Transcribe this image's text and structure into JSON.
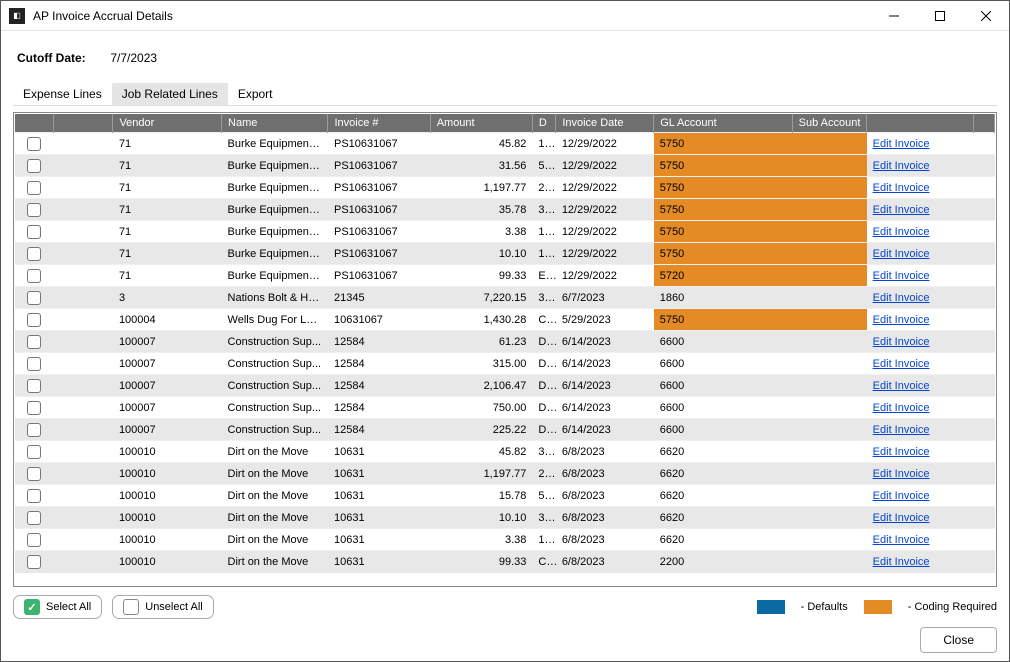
{
  "window": {
    "title": "AP Invoice Accrual Details"
  },
  "cutoff": {
    "label": "Cutoff Date:",
    "value": "7/7/2023"
  },
  "tabs": {
    "expense": "Expense Lines",
    "job": "Job Related Lines",
    "export": "Export"
  },
  "columns": {
    "checkbox": "",
    "row_handle": "",
    "vendor": "Vendor",
    "name": "Name",
    "invoice_no": "Invoice #",
    "amount": "Amount",
    "d": "D",
    "invoice_date": "Invoice Date",
    "gl_account": "GL Account",
    "sub_account": "Sub Account",
    "action": ""
  },
  "rows": [
    {
      "vendor": "71",
      "name": "Burke Equipment ...",
      "invoice_no": "PS10631067",
      "amount": "45.82",
      "d": "1...",
      "invoice_date": "12/29/2022",
      "gl": "5750",
      "gl_coding": true,
      "sub": "",
      "sub_coding": true,
      "action": "Edit Invoice"
    },
    {
      "vendor": "71",
      "name": "Burke Equipment ...",
      "invoice_no": "PS10631067",
      "amount": "31.56",
      "d": "5...",
      "invoice_date": "12/29/2022",
      "gl": "5750",
      "gl_coding": true,
      "sub": "",
      "sub_coding": true,
      "action": "Edit Invoice"
    },
    {
      "vendor": "71",
      "name": "Burke Equipment ...",
      "invoice_no": "PS10631067",
      "amount": "1,197.77",
      "d": "2...",
      "invoice_date": "12/29/2022",
      "gl": "5750",
      "gl_coding": true,
      "sub": "",
      "sub_coding": true,
      "action": "Edit Invoice"
    },
    {
      "vendor": "71",
      "name": "Burke Equipment ...",
      "invoice_no": "PS10631067",
      "amount": "35.78",
      "d": "3...",
      "invoice_date": "12/29/2022",
      "gl": "5750",
      "gl_coding": true,
      "sub": "",
      "sub_coding": true,
      "action": "Edit Invoice"
    },
    {
      "vendor": "71",
      "name": "Burke Equipment ...",
      "invoice_no": "PS10631067",
      "amount": "3.38",
      "d": "1...",
      "invoice_date": "12/29/2022",
      "gl": "5750",
      "gl_coding": true,
      "sub": "",
      "sub_coding": true,
      "action": "Edit Invoice"
    },
    {
      "vendor": "71",
      "name": "Burke Equipment ...",
      "invoice_no": "PS10631067",
      "amount": "10.10",
      "d": "1...",
      "invoice_date": "12/29/2022",
      "gl": "5750",
      "gl_coding": true,
      "sub": "",
      "sub_coding": true,
      "action": "Edit Invoice"
    },
    {
      "vendor": "71",
      "name": "Burke Equipment ...",
      "invoice_no": "PS10631067",
      "amount": "99.33",
      "d": "E..",
      "invoice_date": "12/29/2022",
      "gl": "5720",
      "gl_coding": true,
      "sub": "",
      "sub_coding": true,
      "action": "Edit Invoice"
    },
    {
      "vendor": "3",
      "name": "Nations Bolt & Ha...",
      "invoice_no": "21345",
      "amount": "7,220.15",
      "d": "3...",
      "invoice_date": "6/7/2023",
      "gl": "1860",
      "gl_coding": false,
      "sub": "",
      "sub_coding": false,
      "action": "Edit Invoice"
    },
    {
      "vendor": "100004",
      "name": "Wells Dug For Less",
      "invoice_no": "10631067",
      "amount": "1,430.28",
      "d": "C..",
      "invoice_date": "5/29/2023",
      "gl": "5750",
      "gl_coding": true,
      "sub": "",
      "sub_coding": true,
      "action": "Edit Invoice"
    },
    {
      "vendor": "100007",
      "name": "Construction Sup...",
      "invoice_no": "12584",
      "amount": "61.23",
      "d": "D..",
      "invoice_date": "6/14/2023",
      "gl": "6600",
      "gl_coding": false,
      "sub": "",
      "sub_coding": false,
      "action": "Edit Invoice"
    },
    {
      "vendor": "100007",
      "name": "Construction Sup...",
      "invoice_no": "12584",
      "amount": "315.00",
      "d": "D..",
      "invoice_date": "6/14/2023",
      "gl": "6600",
      "gl_coding": false,
      "sub": "",
      "sub_coding": false,
      "action": "Edit Invoice"
    },
    {
      "vendor": "100007",
      "name": "Construction Sup...",
      "invoice_no": "12584",
      "amount": "2,106.47",
      "d": "D..",
      "invoice_date": "6/14/2023",
      "gl": "6600",
      "gl_coding": false,
      "sub": "",
      "sub_coding": false,
      "action": "Edit Invoice"
    },
    {
      "vendor": "100007",
      "name": "Construction Sup...",
      "invoice_no": "12584",
      "amount": "750.00",
      "d": "D..",
      "invoice_date": "6/14/2023",
      "gl": "6600",
      "gl_coding": false,
      "sub": "",
      "sub_coding": false,
      "action": "Edit Invoice"
    },
    {
      "vendor": "100007",
      "name": "Construction Sup...",
      "invoice_no": "12584",
      "amount": "225.22",
      "d": "D..",
      "invoice_date": "6/14/2023",
      "gl": "6600",
      "gl_coding": false,
      "sub": "",
      "sub_coding": false,
      "action": "Edit Invoice"
    },
    {
      "vendor": "100010",
      "name": "Dirt on the Move",
      "invoice_no": "10631",
      "amount": "45.82",
      "d": "3...",
      "invoice_date": "6/8/2023",
      "gl": "6620",
      "gl_coding": false,
      "sub": "",
      "sub_coding": false,
      "action": "Edit Invoice"
    },
    {
      "vendor": "100010",
      "name": "Dirt on the Move",
      "invoice_no": "10631",
      "amount": "1,197.77",
      "d": "2...",
      "invoice_date": "6/8/2023",
      "gl": "6620",
      "gl_coding": false,
      "sub": "",
      "sub_coding": false,
      "action": "Edit Invoice"
    },
    {
      "vendor": "100010",
      "name": "Dirt on the Move",
      "invoice_no": "10631",
      "amount": "15.78",
      "d": "5...",
      "invoice_date": "6/8/2023",
      "gl": "6620",
      "gl_coding": false,
      "sub": "",
      "sub_coding": false,
      "action": "Edit Invoice"
    },
    {
      "vendor": "100010",
      "name": "Dirt on the Move",
      "invoice_no": "10631",
      "amount": "10.10",
      "d": "3...",
      "invoice_date": "6/8/2023",
      "gl": "6620",
      "gl_coding": false,
      "sub": "",
      "sub_coding": false,
      "action": "Edit Invoice"
    },
    {
      "vendor": "100010",
      "name": "Dirt on the Move",
      "invoice_no": "10631",
      "amount": "3.38",
      "d": "1...",
      "invoice_date": "6/8/2023",
      "gl": "6620",
      "gl_coding": false,
      "sub": "",
      "sub_coding": false,
      "action": "Edit Invoice"
    },
    {
      "vendor": "100010",
      "name": "Dirt on the Move",
      "invoice_no": "10631",
      "amount": "99.33",
      "d": "C..",
      "invoice_date": "6/8/2023",
      "gl": "2200",
      "gl_coding": false,
      "sub": "",
      "sub_coding": false,
      "action": "Edit Invoice"
    }
  ],
  "buttons": {
    "select_all": "Select All",
    "unselect_all": "Unselect All",
    "close": "Close"
  },
  "legend": {
    "defaults": "- Defaults",
    "coding": "- Coding Required"
  }
}
